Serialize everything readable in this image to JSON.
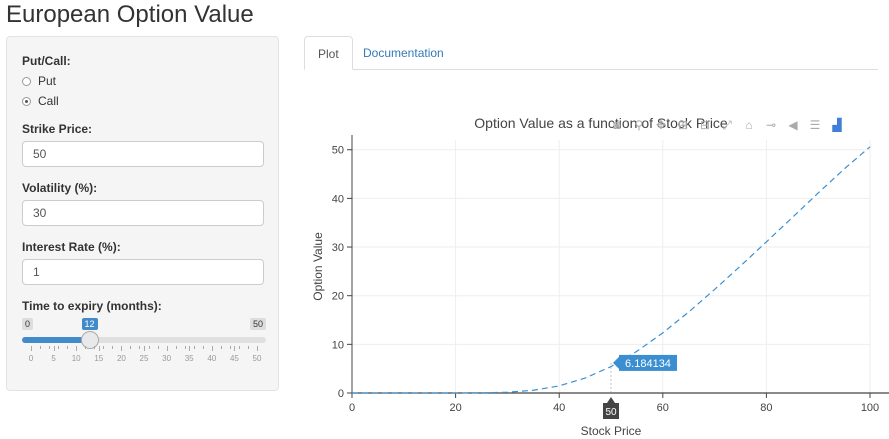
{
  "page_title": "European Option Value",
  "sidebar": {
    "put_call_label": "Put/Call:",
    "options": [
      "Put",
      "Call"
    ],
    "selected": "Call",
    "strike": {
      "label": "Strike Price:",
      "value": "50"
    },
    "volatility": {
      "label": "Volatility (%):",
      "value": "30"
    },
    "interest": {
      "label": "Interest Rate (%):",
      "value": "1"
    },
    "expiry": {
      "label": "Time to expiry (months):",
      "min": "0",
      "max": "50",
      "value": "12",
      "tick_labels": [
        "0",
        "5",
        "10",
        "15",
        "20",
        "25",
        "30",
        "35",
        "40",
        "45",
        "50"
      ]
    }
  },
  "tabs": [
    "Plot",
    "Documentation"
  ],
  "active_tab": "Plot",
  "modebar_icons": [
    "camera-icon",
    "zoom-icon",
    "pan-icon",
    "zoom-in-icon",
    "zoom-out-icon",
    "autoscale-icon",
    "home-icon",
    "spike-icon",
    "compare-hover-icon",
    "closest-hover-icon",
    "plotly-logo-icon"
  ],
  "accent_color": "#428bca",
  "line_color": "#3b8fd1",
  "chart_data": {
    "type": "line",
    "title": "Option Value as a function of Stock Price",
    "xlabel": "Stock Price",
    "ylabel": "Option Value",
    "xlim": [
      0,
      100
    ],
    "ylim": [
      0,
      52
    ],
    "x_ticks": [
      0,
      20,
      40,
      60,
      80,
      100
    ],
    "y_ticks": [
      0,
      10,
      20,
      30,
      40,
      50
    ],
    "x_tick_labels": [
      "0",
      "20",
      "40",
      "60",
      "80",
      "100"
    ],
    "y_tick_labels": [
      "0",
      "10",
      "20",
      "30",
      "40",
      "50"
    ],
    "grid": true,
    "line_style": "dashed",
    "series": [
      {
        "x": [
          0,
          10,
          20,
          25,
          30,
          35,
          40,
          45,
          50,
          55,
          60,
          65,
          70,
          75,
          80,
          85,
          90,
          95,
          100
        ],
        "values": [
          0,
          0,
          0.002,
          0.03,
          0.16,
          0.56,
          1.46,
          3.07,
          5.42,
          8.57,
          12.36,
          16.65,
          21.28,
          26.11,
          31.06,
          36.07,
          41.11,
          46.02,
          50.6
        ]
      }
    ],
    "hover": {
      "x": 50,
      "y": 6.184134,
      "y_label": "6.184134",
      "x_label": "50"
    }
  }
}
